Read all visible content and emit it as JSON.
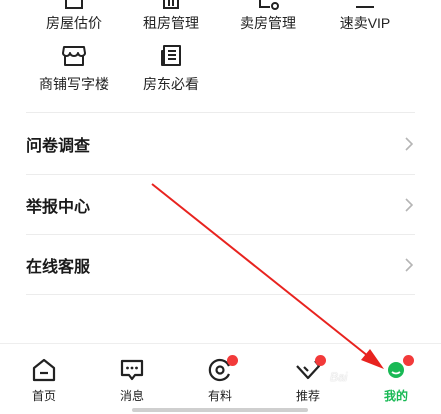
{
  "services": {
    "row1": [
      {
        "label": "房屋估价",
        "icon": "house-valuation-icon"
      },
      {
        "label": "租房管理",
        "icon": "rent-management-icon"
      },
      {
        "label": "卖房管理",
        "icon": "sell-management-icon"
      },
      {
        "label": "速卖VIP",
        "icon": "vip-icon"
      }
    ],
    "row2": [
      {
        "label": "商铺写字楼",
        "icon": "storefront-icon"
      },
      {
        "label": "房东必看",
        "icon": "newspaper-icon"
      }
    ]
  },
  "menu": [
    {
      "label": "问卷调查"
    },
    {
      "label": "举报中心"
    },
    {
      "label": "在线客服"
    }
  ],
  "tabbar": {
    "tabs": [
      {
        "label": "首页",
        "icon": "home-icon"
      },
      {
        "label": "消息",
        "icon": "message-icon"
      },
      {
        "label": "有料",
        "icon": "discover-icon",
        "badge": true
      },
      {
        "label": "推荐",
        "icon": "recommend-icon",
        "badge": true
      },
      {
        "label": "我的",
        "icon": "profile-icon",
        "badge": true,
        "active": true
      }
    ]
  },
  "colors": {
    "accent": "#19b955",
    "badge": "#f23a3a",
    "annotation_arrow": "#e8231f"
  },
  "watermark": "Bai"
}
